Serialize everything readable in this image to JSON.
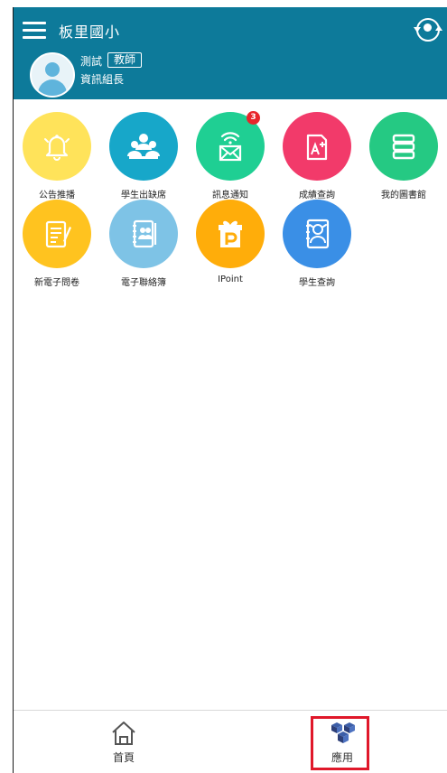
{
  "header": {
    "school_name": "板里國小",
    "user_name": "測試",
    "role": "教師",
    "title": "資訊組長"
  },
  "apps": [
    {
      "label": "公告推播",
      "icon": "bell-icon",
      "color": "#ffe35a"
    },
    {
      "label": "學生出缺席",
      "icon": "students-icon",
      "color": "#17a7c9"
    },
    {
      "label": "訊息通知",
      "icon": "wifi-envelope-icon",
      "color": "#1fcf93",
      "badge": "3"
    },
    {
      "label": "成績查詢",
      "icon": "grade-document-icon",
      "color": "#f23a6a"
    },
    {
      "label": "我的圖書館",
      "icon": "books-icon",
      "color": "#25c983"
    },
    {
      "label": "新電子問卷",
      "icon": "questionnaire-icon",
      "color": "#ffc31f"
    },
    {
      "label": "電子聯絡簿",
      "icon": "contact-book-icon",
      "color": "#7ec3e6"
    },
    {
      "label": "IPoint",
      "icon": "gift-p-icon",
      "color": "#ffad0a"
    },
    {
      "label": "學生查詢",
      "icon": "student-profile-icon",
      "color": "#3a8fe6"
    }
  ],
  "tabbar": {
    "home_label": "首頁",
    "apps_label": "應用"
  },
  "colors": {
    "header_bg": "#0d7a9a",
    "highlight": "#e0182a"
  }
}
